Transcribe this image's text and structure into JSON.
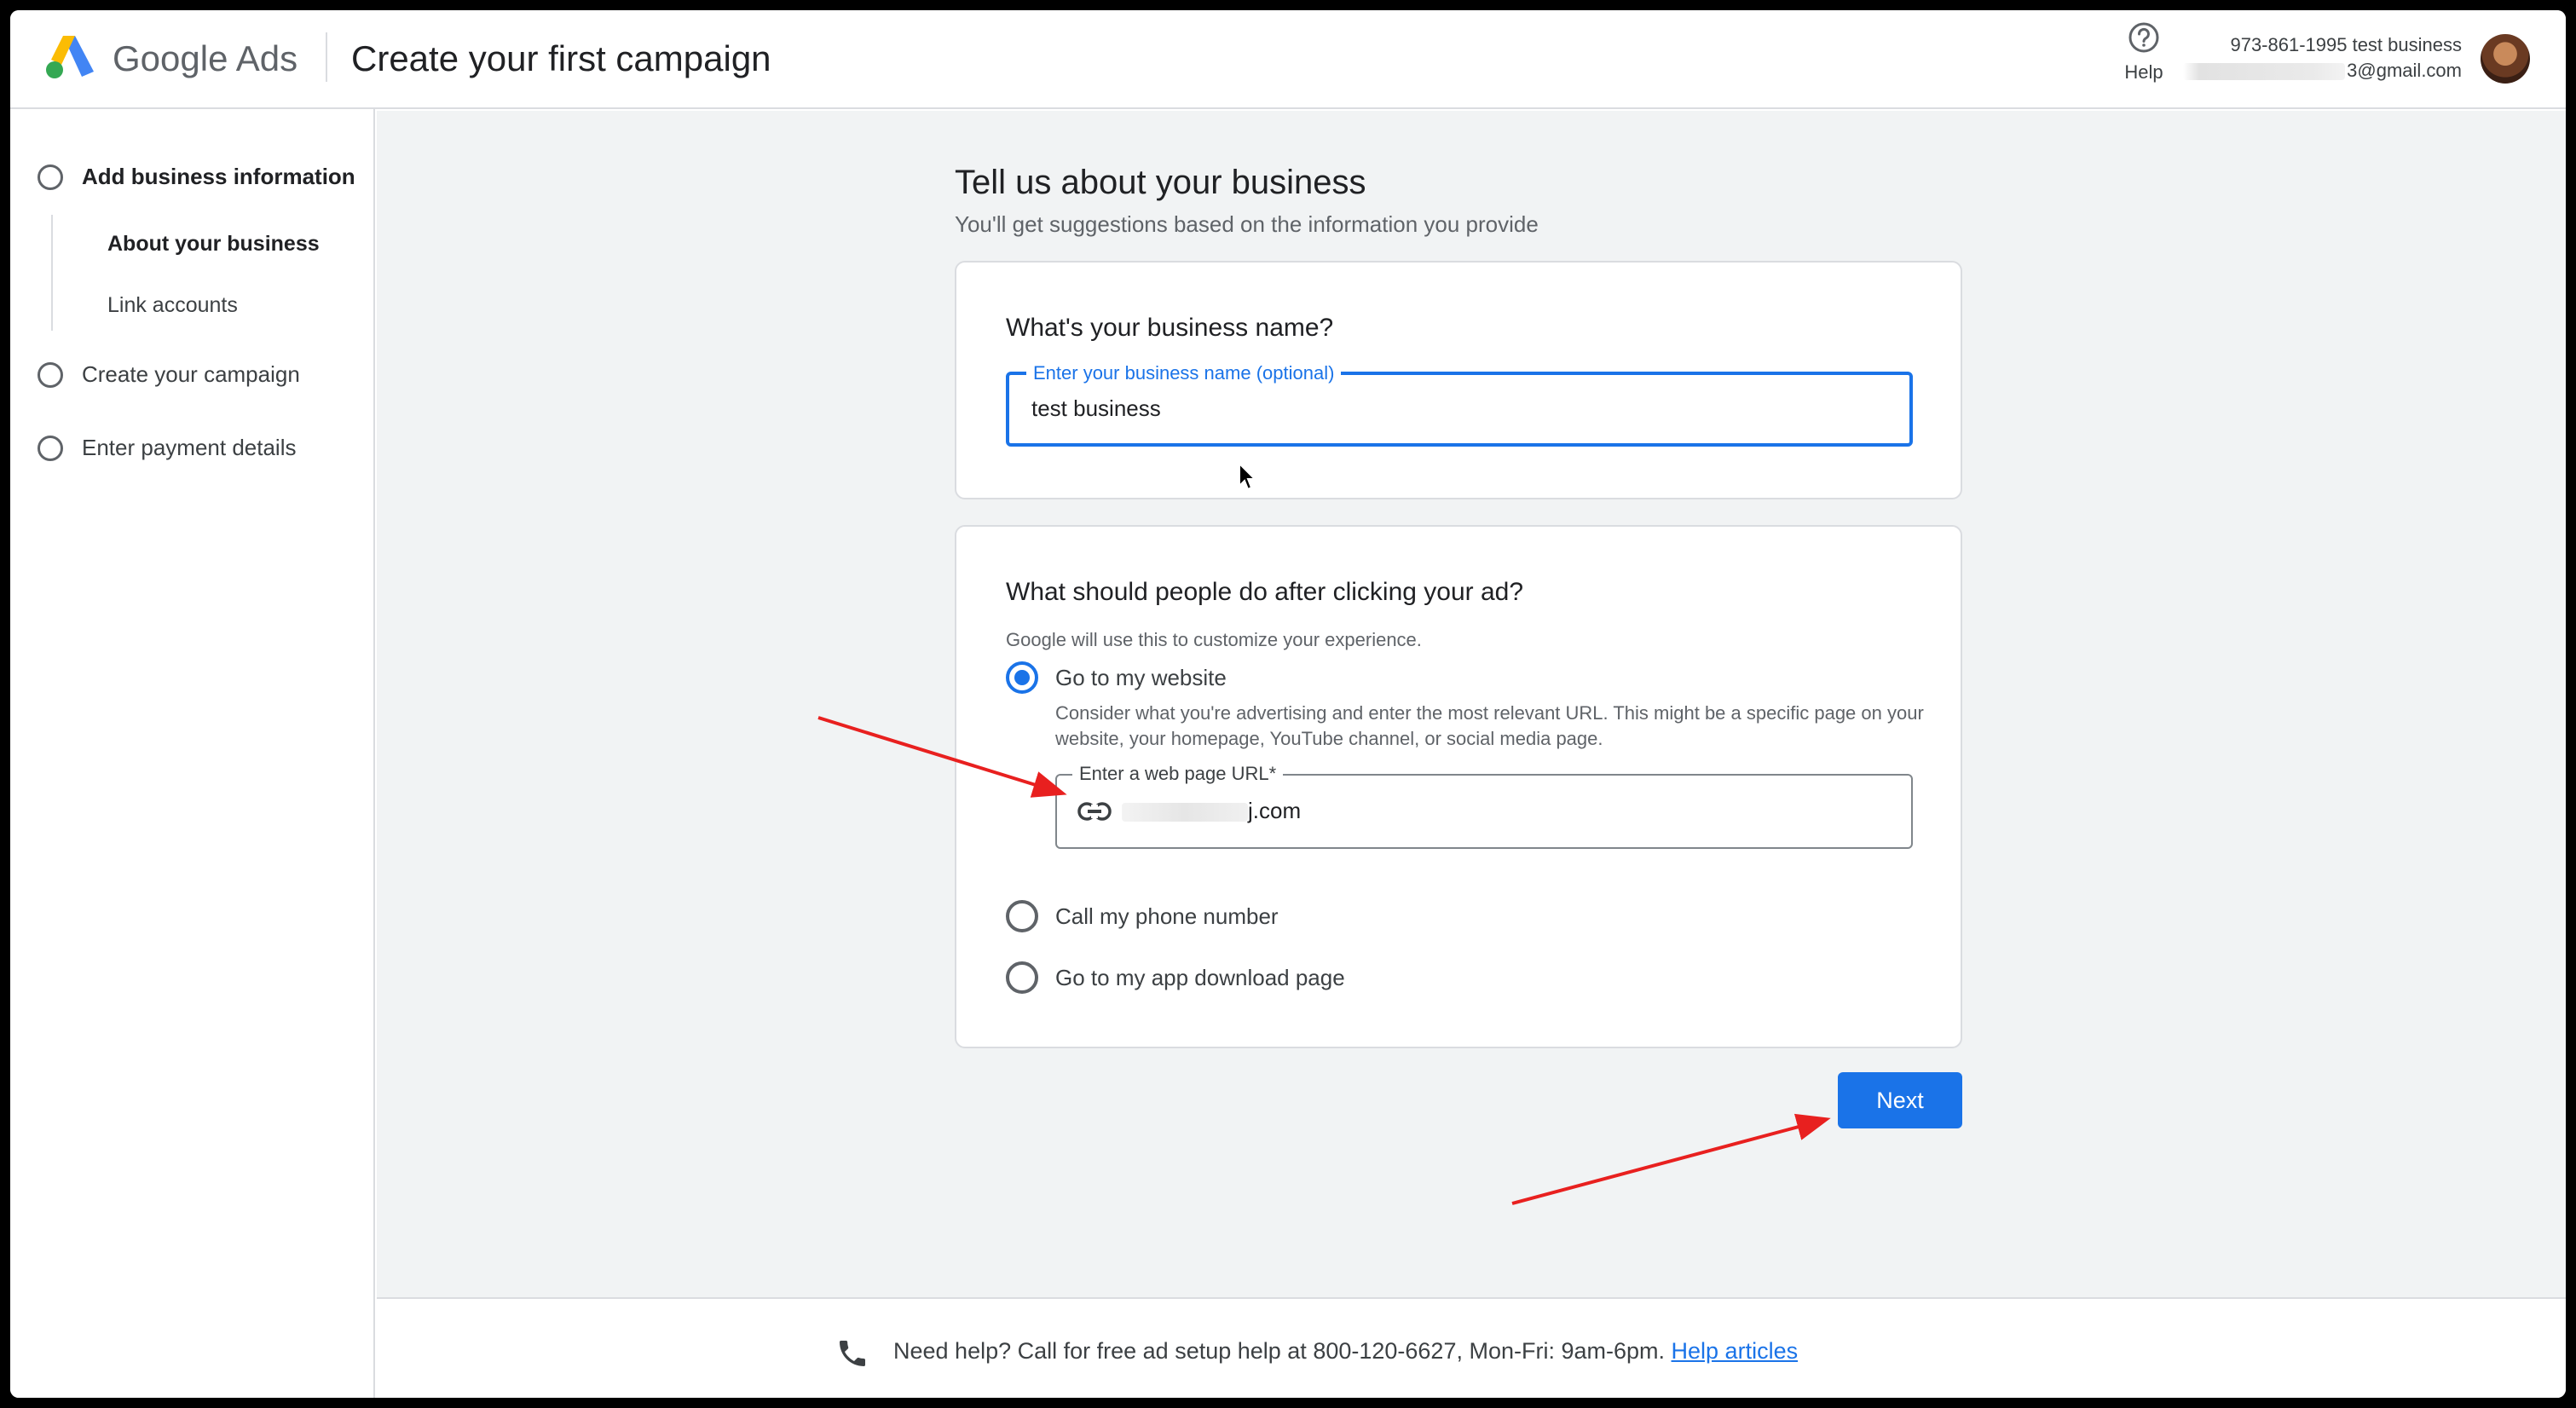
{
  "header": {
    "brand_google": "Google",
    "brand_ads": "Ads",
    "title": "Create your first campaign",
    "help_label": "Help",
    "account_name": "973-861-1995 test business",
    "account_email_suffix": "3@gmail.com"
  },
  "sidebar": {
    "steps": [
      {
        "label": "Add business information"
      },
      {
        "label": "Create your campaign"
      },
      {
        "label": "Enter payment details"
      }
    ],
    "substeps": [
      {
        "label": "About your business"
      },
      {
        "label": "Link accounts"
      }
    ]
  },
  "main": {
    "title": "Tell us about your business",
    "subtitle": "You'll get suggestions based on the information you provide",
    "business_card": {
      "question": "What's your business name?",
      "field_label": "Enter your business name (optional)",
      "field_value": "test business"
    },
    "action_card": {
      "question": "What should people do after clicking your ad?",
      "hint": "Google will use this to customize your experience.",
      "options": [
        {
          "label": "Go to my website",
          "selected": true,
          "description": "Consider what you're advertising and enter the most relevant URL. This might be a specific page on your website, your homepage, YouTube channel, or social media page."
        },
        {
          "label": "Call my phone number",
          "selected": false
        },
        {
          "label": "Go to my app download page",
          "selected": false
        }
      ],
      "url_field_label": "Enter a web page URL*",
      "url_value_suffix": "j.com"
    },
    "next_label": "Next"
  },
  "footer": {
    "text": "Need help? Call for free ad setup help at 800-120-6627, Mon-Fri: 9am-6pm.",
    "link": "Help articles"
  },
  "colors": {
    "accent": "#1a73e8",
    "annotation_arrow": "#e8201f",
    "background": "#f1f3f4"
  }
}
